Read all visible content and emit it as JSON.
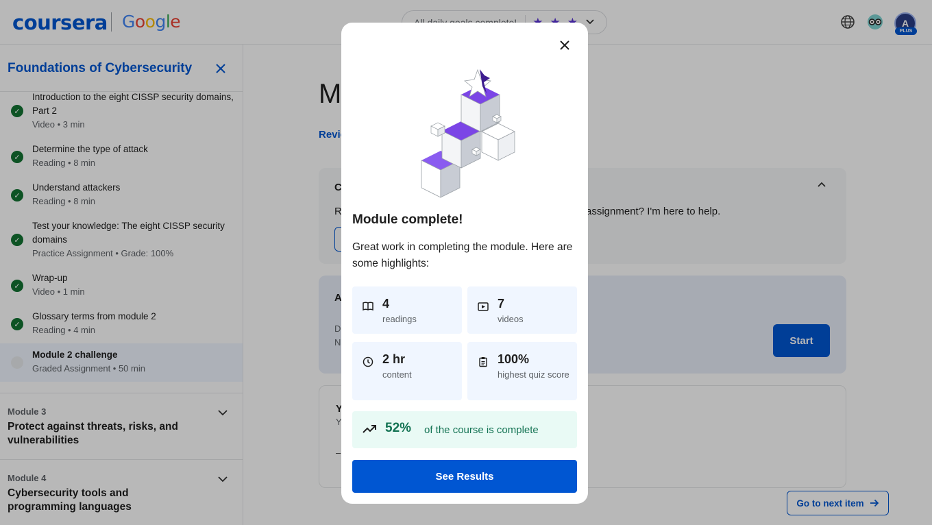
{
  "header": {
    "logo_coursera": "coursera",
    "logo_google": [
      "G",
      "o",
      "o",
      "g",
      "l",
      "e"
    ],
    "daily_goals_text": "All daily goals complete!",
    "language_icon": "globe-icon",
    "coach_icon": "coach-glasses-icon",
    "avatar_letter": "A",
    "avatar_badge": "PLUS"
  },
  "sidebar": {
    "title": "Foundations of Cybersecurity",
    "items": [
      {
        "title": "Introduction to the eight CISSP security domains, Part 2",
        "meta": "Video • 3 min",
        "done": true
      },
      {
        "title": "Determine the type of attack",
        "meta": "Reading • 8 min",
        "done": true
      },
      {
        "title": "Understand attackers",
        "meta": "Reading • 8 min",
        "done": true
      },
      {
        "title": "Test your knowledge: The eight CISSP security domains",
        "meta": "Practice Assignment • Grade: 100%",
        "done": true
      },
      {
        "title": "Wrap-up",
        "meta": "Video • 1 min",
        "done": true
      },
      {
        "title": "Glossary terms from module 2",
        "meta": "Reading • 4 min",
        "done": true
      },
      {
        "title": "Module 2 challenge",
        "meta": "Graded Assignment • 50 min",
        "done": false
      }
    ],
    "modules": [
      {
        "label": "Module 3",
        "title": "Protect against threats, risks, and vulnerabilities"
      },
      {
        "label": "Module 4",
        "title": "Cybersecurity tools and programming languages"
      }
    ]
  },
  "main": {
    "title_partial": "M",
    "link_partial": "Revie",
    "coach_card_title_partial": "C",
    "coach_card_text_partial_left": "R",
    "coach_card_text_partial_right": "assignment? I'm here to help.",
    "assignment_card_title_partial": "A",
    "assignment_card_line1_partial": "D",
    "assignment_card_line2_partial": "N",
    "start_label": "Start",
    "grade_card_title_partial": "Y",
    "grade_card_line_partial": "Y",
    "grade_card_dash": "–",
    "next_item_label": "Go to next item"
  },
  "modal": {
    "title": "Module complete!",
    "text": "Great work in completing the module. Here are some highlights:",
    "stats": [
      {
        "icon": "book-icon",
        "value": "4",
        "label": "readings"
      },
      {
        "icon": "video-icon",
        "value": "7",
        "label": "videos"
      },
      {
        "icon": "clock-icon",
        "value": "2 hr",
        "label": "content"
      },
      {
        "icon": "clipboard-icon",
        "value": "100%",
        "label": "highest quiz score"
      }
    ],
    "progress_pct": "52%",
    "progress_text": "of the course is complete",
    "results_label": "See Results"
  },
  "colors": {
    "brand_blue": "#0056d2",
    "success_green": "#137333",
    "progress_green": "#137353",
    "illustration_purple": "#7c4dff"
  }
}
